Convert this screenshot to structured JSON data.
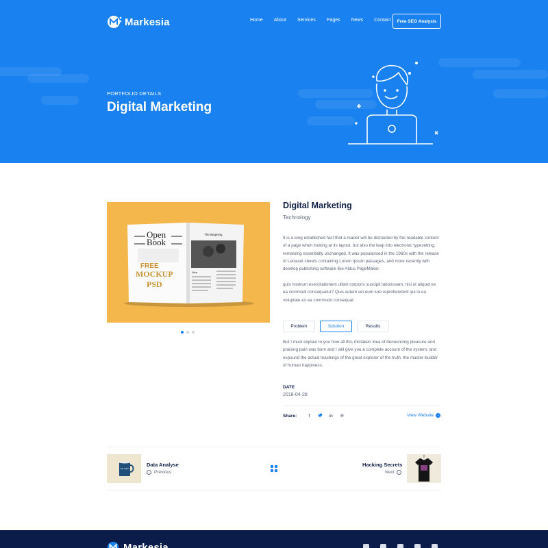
{
  "brand": {
    "name": "Markesia"
  },
  "nav": {
    "items": [
      "Home",
      "About",
      "Services",
      "Pages",
      "News",
      "Contact"
    ],
    "cta": "Free SEO Analysis"
  },
  "hero": {
    "eyebrow": "PORTFOLIO DETAILS",
    "title": "Digital Marketing"
  },
  "gallery": {
    "book_title_line1": "Open",
    "book_title_line2": "Book",
    "book_blurb": "This is a fully-editable open book mockup created in Photoshop using smart object layers. Use double-click the top two layers to add your own page designs. You can also change the background and shadow of the mockup.",
    "mockup_line1": "FREE",
    "mockup_line2": "MOCKUP",
    "mockup_line3": "PSD",
    "right_page_heading": "The Begining",
    "right_page_sub": "Nice",
    "active_slide": 1,
    "slides_count": 3
  },
  "detail": {
    "title": "Digital Marketing",
    "category": "Technology",
    "para1": "It is a long established fact that a reader will be distracted by the readable content of a page when looking at its layout.  but also the leap into electronic typesetting, remaining essentially unchanged. It was popularised in the 1960s with the release of Letraset sheets containing Lorem Ipsum passages, and more recently with desktop publishing software like Aldus PageMaker.",
    "para2": "quis nostrum exercitationem ullam corporis suscipit laboriosam, nisi ut aliquid ex ea commodi consequatur? Quis autem vel eum iure reprehenderit qui in ea voluptate  ex ea commodo consequat.",
    "tabs": [
      {
        "label": "Problem",
        "active": false
      },
      {
        "label": "Solution",
        "active": true
      },
      {
        "label": "Results",
        "active": false
      }
    ],
    "tab_text": "But I must explain to you how all this mistaken idea of denouncing pleasure and praising pain was born and I will give you a complete account of the system, and expound the actual teachings of the great explorer of the truth, the master-builder of human happiness.",
    "date_label": "DATE",
    "date_value": "2018-04-28",
    "share_label": "Share:",
    "share_icons": [
      "facebook-icon",
      "twitter-icon",
      "linkedin-icon",
      "pinterest-icon"
    ],
    "view_website": "View Website"
  },
  "pager": {
    "prev_title": "Data Analyse",
    "prev_label": "Previous",
    "prev_mug_text": "My Super",
    "next_title": "Hacking Secrets",
    "next_label": "Next"
  },
  "footer": {
    "brand": "Markesia"
  },
  "colors": {
    "primary": "#1a82f0",
    "navy": "#0f1f45",
    "footer": "#0c1c4a",
    "gallery_bg": "#f3b74b"
  }
}
